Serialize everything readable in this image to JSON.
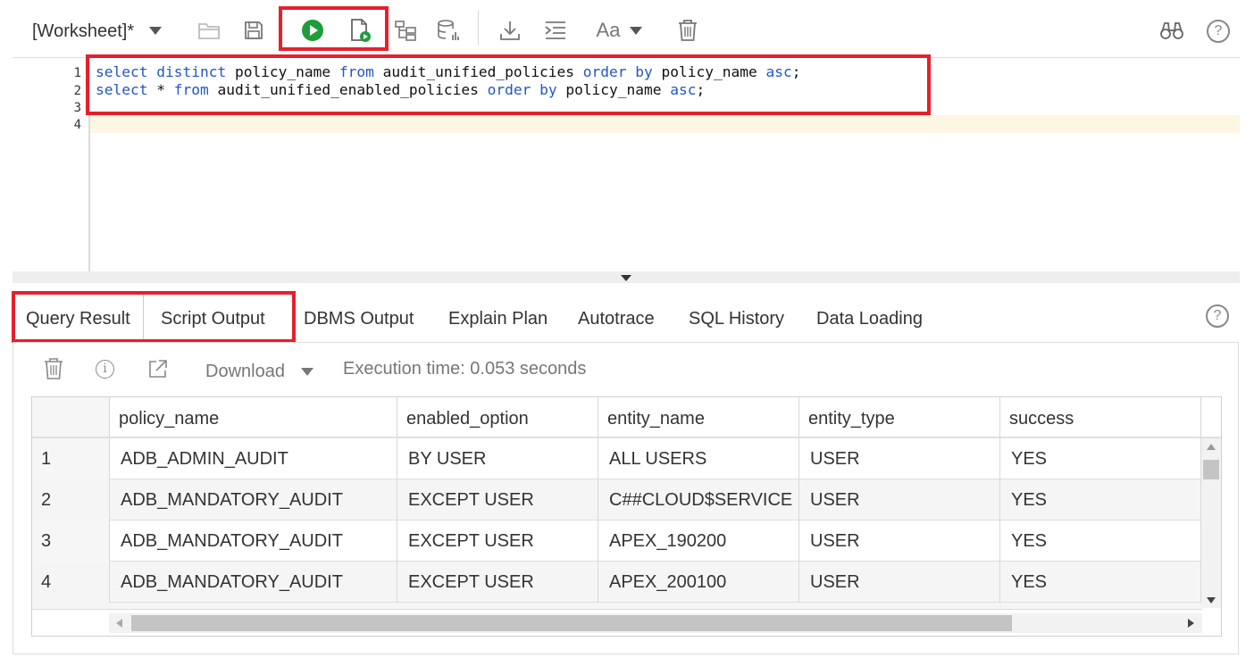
{
  "toolbar": {
    "worksheet_title": "[Worksheet]*",
    "icons": [
      "open-folder-icon",
      "save-icon",
      "run-statement-icon",
      "run-script-icon",
      "explain-plan-icon",
      "autotrace-icon",
      "download-icon",
      "format-icon",
      "font-case-icon",
      "trash-icon",
      "find-binoculars-icon",
      "help-icon"
    ],
    "font_label": "Aa"
  },
  "editor": {
    "line_numbers": [
      "1",
      "2",
      "3",
      "4"
    ],
    "lines": [
      [
        {
          "t": "select",
          "k": true
        },
        {
          "t": " "
        },
        {
          "t": "distinct",
          "k": true
        },
        {
          "t": " policy_name "
        },
        {
          "t": "from",
          "k": true
        },
        {
          "t": " audit_unified_policies "
        },
        {
          "t": "order",
          "k": true
        },
        {
          "t": " "
        },
        {
          "t": "by",
          "k": true
        },
        {
          "t": " policy_name "
        },
        {
          "t": "asc",
          "k": true
        },
        {
          "t": ";"
        }
      ],
      [
        {
          "t": "select",
          "k": true
        },
        {
          "t": " * "
        },
        {
          "t": "from",
          "k": true
        },
        {
          "t": " audit_unified_enabled_policies "
        },
        {
          "t": "order",
          "k": true
        },
        {
          "t": " "
        },
        {
          "t": "by",
          "k": true
        },
        {
          "t": " policy_name "
        },
        {
          "t": "asc",
          "k": true
        },
        {
          "t": ";"
        }
      ],
      [],
      []
    ]
  },
  "tabs": [
    "Query Result",
    "Script Output",
    "DBMS Output",
    "Explain Plan",
    "Autotrace",
    "SQL History",
    "Data Loading"
  ],
  "result": {
    "download_label": "Download",
    "execution_time": "Execution time: 0.053 seconds"
  },
  "grid": {
    "columns": [
      "policy_name",
      "enabled_option",
      "entity_name",
      "entity_type",
      "success"
    ],
    "rows": [
      [
        "1",
        "ADB_ADMIN_AUDIT",
        "BY USER",
        "ALL USERS",
        "USER",
        "YES"
      ],
      [
        "2",
        "ADB_MANDATORY_AUDIT",
        "EXCEPT USER",
        "C##CLOUD$SERVICE",
        "USER",
        "YES"
      ],
      [
        "3",
        "ADB_MANDATORY_AUDIT",
        "EXCEPT USER",
        "APEX_190200",
        "USER",
        "YES"
      ],
      [
        "4",
        "ADB_MANDATORY_AUDIT",
        "EXCEPT USER",
        "APEX_200100",
        "USER",
        "YES"
      ]
    ]
  },
  "colors": {
    "highlight": "#e5202c",
    "run_green": "#1f9d3a",
    "keyword": "#2356c7"
  }
}
